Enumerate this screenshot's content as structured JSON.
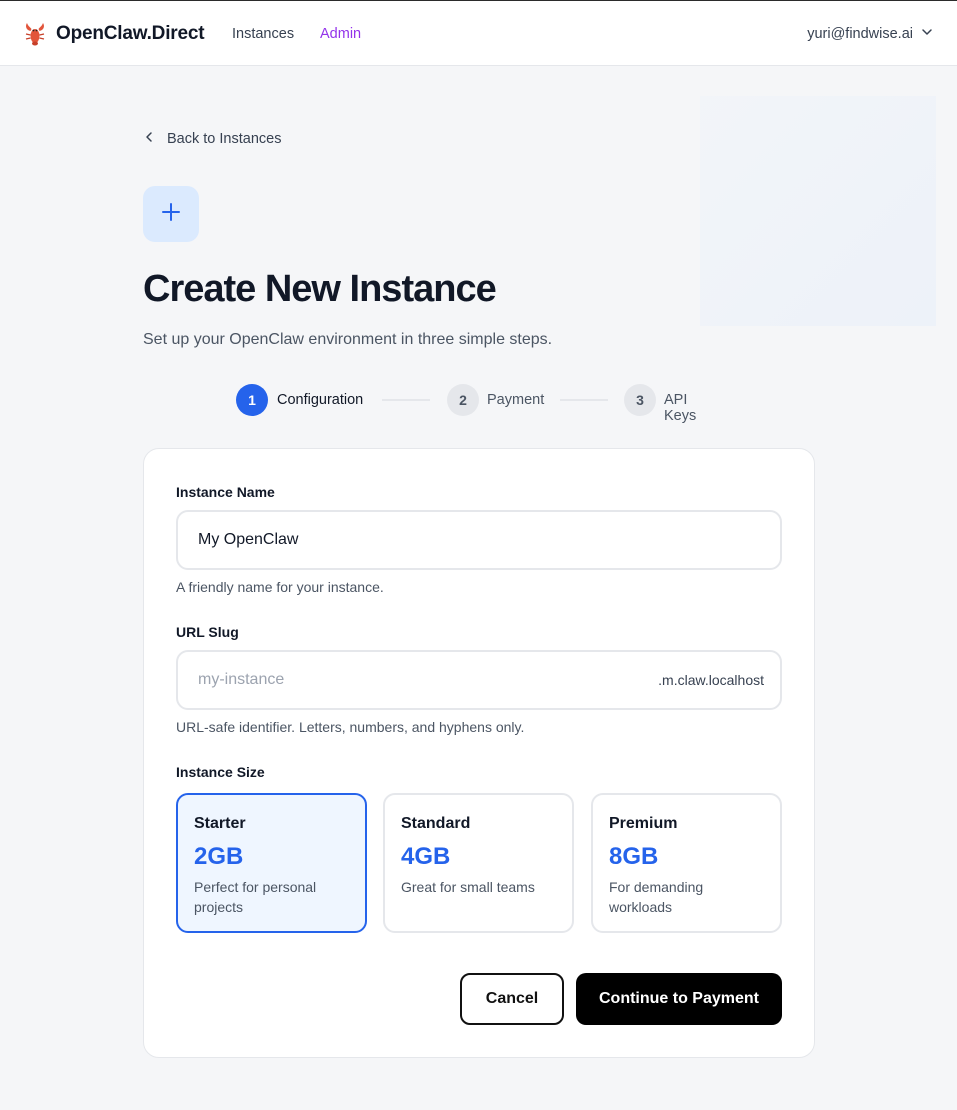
{
  "header": {
    "brand": "OpenClaw.Direct",
    "nav": [
      {
        "label": "Instances"
      },
      {
        "label": "Admin"
      }
    ],
    "user_email": "yuri@findwise.ai"
  },
  "back_link": "Back to Instances",
  "page": {
    "title": "Create New Instance",
    "subtitle": "Set up your OpenClaw environment in three simple steps."
  },
  "steps": [
    {
      "number": "1",
      "label": "Configuration",
      "active": true
    },
    {
      "number": "2",
      "label": "Payment",
      "active": false
    },
    {
      "number": "3",
      "label": "API Keys",
      "active": false
    }
  ],
  "form": {
    "name": {
      "label": "Instance Name",
      "value": "My OpenClaw",
      "help": "A friendly name for your instance."
    },
    "slug": {
      "label": "URL Slug",
      "placeholder": "my-instance",
      "value": "",
      "suffix": ".m.claw.localhost",
      "help": "URL-safe identifier. Letters, numbers, and hyphens only."
    },
    "size": {
      "label": "Instance Size",
      "selected": "Starter",
      "options": [
        {
          "name": "Starter",
          "memory": "2GB",
          "description": "Perfect for personal projects"
        },
        {
          "name": "Standard",
          "memory": "4GB",
          "description": "Great for small teams"
        },
        {
          "name": "Premium",
          "memory": "8GB",
          "description": "For demanding workloads"
        }
      ]
    }
  },
  "actions": {
    "cancel": "Cancel",
    "continue": "Continue to Payment"
  },
  "colors": {
    "primary": "#2563eb",
    "admin_link": "#9333ea",
    "selected_bg": "#eff6ff",
    "icon_tile_bg": "#dbeafe",
    "button_dark": "#000000"
  },
  "icons": {
    "logo": "lobster-icon",
    "back": "chevron-left-icon",
    "user_menu": "chevron-down-icon",
    "create": "plus-icon"
  }
}
